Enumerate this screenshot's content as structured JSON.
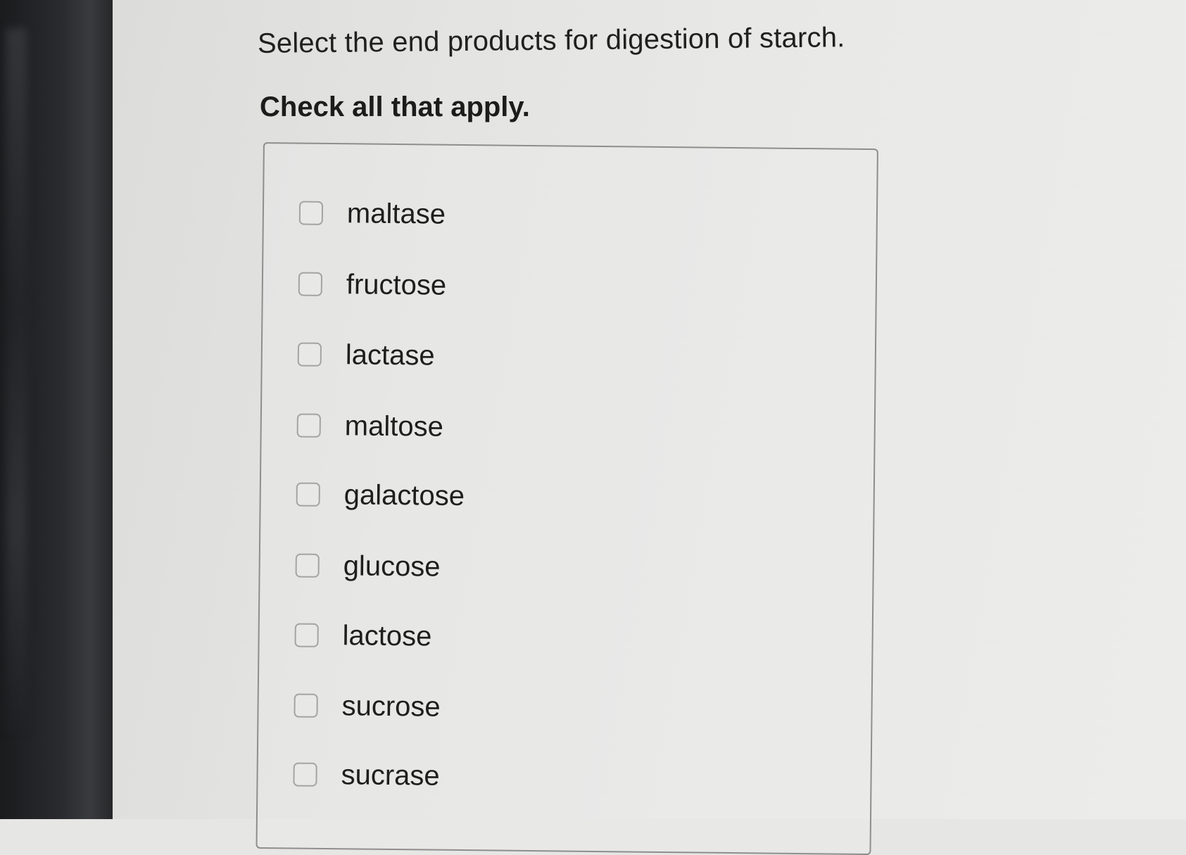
{
  "question": {
    "text": "Select the end products for digestion of starch.",
    "instruction": "Check all that apply."
  },
  "options": [
    {
      "label": "maltase",
      "checked": false
    },
    {
      "label": "fructose",
      "checked": false
    },
    {
      "label": "lactase",
      "checked": false
    },
    {
      "label": "maltose",
      "checked": false
    },
    {
      "label": "galactose",
      "checked": false
    },
    {
      "label": "glucose",
      "checked": false
    },
    {
      "label": "lactose",
      "checked": false
    },
    {
      "label": "sucrose",
      "checked": false
    },
    {
      "label": "sucrase",
      "checked": false
    }
  ]
}
